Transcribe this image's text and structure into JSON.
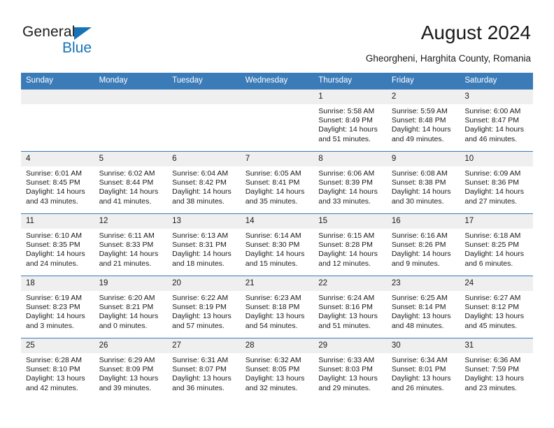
{
  "brand": {
    "name_primary": "General",
    "name_secondary": "Blue",
    "accent_color": "#1673b8"
  },
  "header": {
    "title": "August 2024",
    "location": "Gheorgheni, Harghita County, Romania"
  },
  "theme": {
    "header_row_bg": "#3b7cb8",
    "day_band_bg": "#efefef",
    "text_color": "#1a1a1a"
  },
  "calendar": {
    "weekday_headers": [
      "Sunday",
      "Monday",
      "Tuesday",
      "Wednesday",
      "Thursday",
      "Friday",
      "Saturday"
    ],
    "labels": {
      "sunrise": "Sunrise:",
      "sunset": "Sunset:",
      "daylight": "Daylight:"
    },
    "weeks": [
      [
        {
          "day": "",
          "empty": true
        },
        {
          "day": "",
          "empty": true
        },
        {
          "day": "",
          "empty": true
        },
        {
          "day": "",
          "empty": true
        },
        {
          "day": "1",
          "sunrise": "Sunrise: 5:58 AM",
          "sunset": "Sunset: 8:49 PM",
          "daylight": "Daylight: 14 hours and 51 minutes."
        },
        {
          "day": "2",
          "sunrise": "Sunrise: 5:59 AM",
          "sunset": "Sunset: 8:48 PM",
          "daylight": "Daylight: 14 hours and 49 minutes."
        },
        {
          "day": "3",
          "sunrise": "Sunrise: 6:00 AM",
          "sunset": "Sunset: 8:47 PM",
          "daylight": "Daylight: 14 hours and 46 minutes."
        }
      ],
      [
        {
          "day": "4",
          "sunrise": "Sunrise: 6:01 AM",
          "sunset": "Sunset: 8:45 PM",
          "daylight": "Daylight: 14 hours and 43 minutes."
        },
        {
          "day": "5",
          "sunrise": "Sunrise: 6:02 AM",
          "sunset": "Sunset: 8:44 PM",
          "daylight": "Daylight: 14 hours and 41 minutes."
        },
        {
          "day": "6",
          "sunrise": "Sunrise: 6:04 AM",
          "sunset": "Sunset: 8:42 PM",
          "daylight": "Daylight: 14 hours and 38 minutes."
        },
        {
          "day": "7",
          "sunrise": "Sunrise: 6:05 AM",
          "sunset": "Sunset: 8:41 PM",
          "daylight": "Daylight: 14 hours and 35 minutes."
        },
        {
          "day": "8",
          "sunrise": "Sunrise: 6:06 AM",
          "sunset": "Sunset: 8:39 PM",
          "daylight": "Daylight: 14 hours and 33 minutes."
        },
        {
          "day": "9",
          "sunrise": "Sunrise: 6:08 AM",
          "sunset": "Sunset: 8:38 PM",
          "daylight": "Daylight: 14 hours and 30 minutes."
        },
        {
          "day": "10",
          "sunrise": "Sunrise: 6:09 AM",
          "sunset": "Sunset: 8:36 PM",
          "daylight": "Daylight: 14 hours and 27 minutes."
        }
      ],
      [
        {
          "day": "11",
          "sunrise": "Sunrise: 6:10 AM",
          "sunset": "Sunset: 8:35 PM",
          "daylight": "Daylight: 14 hours and 24 minutes."
        },
        {
          "day": "12",
          "sunrise": "Sunrise: 6:11 AM",
          "sunset": "Sunset: 8:33 PM",
          "daylight": "Daylight: 14 hours and 21 minutes."
        },
        {
          "day": "13",
          "sunrise": "Sunrise: 6:13 AM",
          "sunset": "Sunset: 8:31 PM",
          "daylight": "Daylight: 14 hours and 18 minutes."
        },
        {
          "day": "14",
          "sunrise": "Sunrise: 6:14 AM",
          "sunset": "Sunset: 8:30 PM",
          "daylight": "Daylight: 14 hours and 15 minutes."
        },
        {
          "day": "15",
          "sunrise": "Sunrise: 6:15 AM",
          "sunset": "Sunset: 8:28 PM",
          "daylight": "Daylight: 14 hours and 12 minutes."
        },
        {
          "day": "16",
          "sunrise": "Sunrise: 6:16 AM",
          "sunset": "Sunset: 8:26 PM",
          "daylight": "Daylight: 14 hours and 9 minutes."
        },
        {
          "day": "17",
          "sunrise": "Sunrise: 6:18 AM",
          "sunset": "Sunset: 8:25 PM",
          "daylight": "Daylight: 14 hours and 6 minutes."
        }
      ],
      [
        {
          "day": "18",
          "sunrise": "Sunrise: 6:19 AM",
          "sunset": "Sunset: 8:23 PM",
          "daylight": "Daylight: 14 hours and 3 minutes."
        },
        {
          "day": "19",
          "sunrise": "Sunrise: 6:20 AM",
          "sunset": "Sunset: 8:21 PM",
          "daylight": "Daylight: 14 hours and 0 minutes."
        },
        {
          "day": "20",
          "sunrise": "Sunrise: 6:22 AM",
          "sunset": "Sunset: 8:19 PM",
          "daylight": "Daylight: 13 hours and 57 minutes."
        },
        {
          "day": "21",
          "sunrise": "Sunrise: 6:23 AM",
          "sunset": "Sunset: 8:18 PM",
          "daylight": "Daylight: 13 hours and 54 minutes."
        },
        {
          "day": "22",
          "sunrise": "Sunrise: 6:24 AM",
          "sunset": "Sunset: 8:16 PM",
          "daylight": "Daylight: 13 hours and 51 minutes."
        },
        {
          "day": "23",
          "sunrise": "Sunrise: 6:25 AM",
          "sunset": "Sunset: 8:14 PM",
          "daylight": "Daylight: 13 hours and 48 minutes."
        },
        {
          "day": "24",
          "sunrise": "Sunrise: 6:27 AM",
          "sunset": "Sunset: 8:12 PM",
          "daylight": "Daylight: 13 hours and 45 minutes."
        }
      ],
      [
        {
          "day": "25",
          "sunrise": "Sunrise: 6:28 AM",
          "sunset": "Sunset: 8:10 PM",
          "daylight": "Daylight: 13 hours and 42 minutes."
        },
        {
          "day": "26",
          "sunrise": "Sunrise: 6:29 AM",
          "sunset": "Sunset: 8:09 PM",
          "daylight": "Daylight: 13 hours and 39 minutes."
        },
        {
          "day": "27",
          "sunrise": "Sunrise: 6:31 AM",
          "sunset": "Sunset: 8:07 PM",
          "daylight": "Daylight: 13 hours and 36 minutes."
        },
        {
          "day": "28",
          "sunrise": "Sunrise: 6:32 AM",
          "sunset": "Sunset: 8:05 PM",
          "daylight": "Daylight: 13 hours and 32 minutes."
        },
        {
          "day": "29",
          "sunrise": "Sunrise: 6:33 AM",
          "sunset": "Sunset: 8:03 PM",
          "daylight": "Daylight: 13 hours and 29 minutes."
        },
        {
          "day": "30",
          "sunrise": "Sunrise: 6:34 AM",
          "sunset": "Sunset: 8:01 PM",
          "daylight": "Daylight: 13 hours and 26 minutes."
        },
        {
          "day": "31",
          "sunrise": "Sunrise: 6:36 AM",
          "sunset": "Sunset: 7:59 PM",
          "daylight": "Daylight: 13 hours and 23 minutes."
        }
      ]
    ]
  }
}
